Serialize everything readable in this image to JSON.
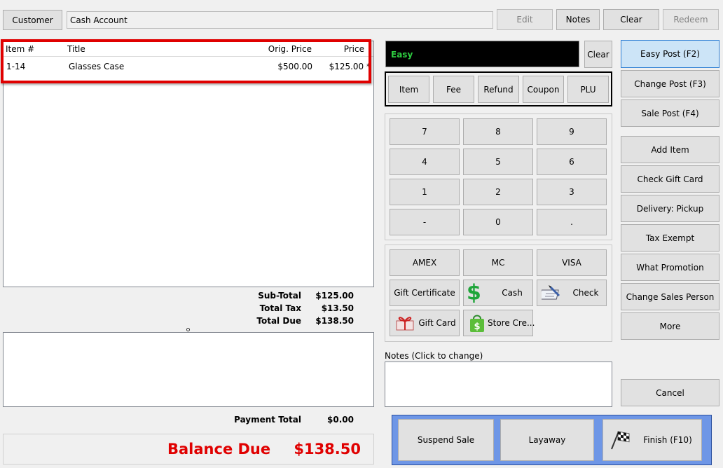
{
  "top": {
    "customer_label": "Customer",
    "customer_value": "Cash Account",
    "edit_label": "Edit",
    "notes_label": "Notes",
    "clear_label": "Clear",
    "redeem_label": "Redeem"
  },
  "items_table": {
    "headers": [
      "Item #",
      "Title",
      "Orig. Price",
      "Price"
    ],
    "rows": [
      {
        "item": "1-14",
        "title": "Glasses Case",
        "orig_price": "$500.00",
        "price": "$125.00 *"
      }
    ]
  },
  "totals": {
    "subtotal_label": "Sub-Total",
    "subtotal": "$125.00",
    "tax_label": "Total Tax",
    "tax": "$13.50",
    "due_label": "Total Due",
    "due": "$138.50",
    "payment_label": "Payment Total",
    "payment": "$0.00",
    "balance_label": "Balance Due",
    "balance": "$138.50"
  },
  "entry": {
    "mode_text": "Easy",
    "clear_label": "Clear",
    "types": [
      "Item",
      "Fee",
      "Refund",
      "Coupon",
      "PLU"
    ]
  },
  "keypad": [
    "7",
    "8",
    "9",
    "4",
    "5",
    "6",
    "1",
    "2",
    "3",
    "-",
    "0",
    "."
  ],
  "tenders": {
    "amex": "AMEX",
    "mc": "MC",
    "visa": "VISA",
    "gift_certificate": "Gift Certificate",
    "cash": "Cash",
    "check": "Check",
    "gift_card": "Gift Card",
    "store_credit": "Store Cre..."
  },
  "notes_caption": "Notes (Click to change)",
  "right": {
    "easy_post": "Easy Post (F2)",
    "change_post": "Change Post (F3)",
    "sale_post": "Sale Post (F4)",
    "add_item": "Add Item",
    "check_gift_card": "Check Gift Card",
    "delivery": "Delivery: Pickup",
    "tax_exempt": "Tax Exempt",
    "what_promotion": "What Promotion",
    "change_sales_person": "Change Sales Person",
    "more": "More",
    "cancel": "Cancel"
  },
  "bottom": {
    "suspend": "Suspend Sale",
    "layaway": "Layaway",
    "finish": "Finish (F10)"
  },
  "colors": {
    "balance_red": "#e00000",
    "mode_green": "#2ecc40",
    "highlight_red": "#e00000",
    "finish_panel": "#6e96e6"
  }
}
